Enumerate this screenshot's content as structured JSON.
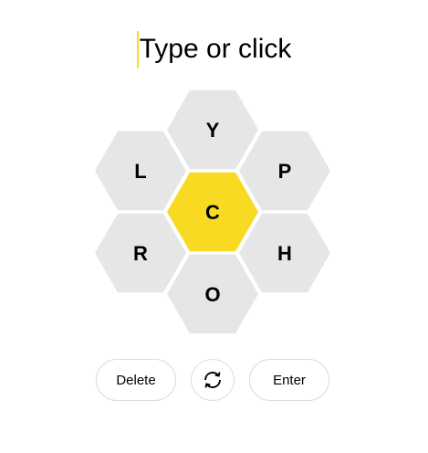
{
  "input": {
    "placeholder": "Type or click"
  },
  "hive": {
    "center_letter": "C",
    "outer_letters": [
      "Y",
      "P",
      "H",
      "O",
      "R",
      "L"
    ],
    "center_color": "#f7da21",
    "outer_color": "#e6e6e6"
  },
  "controls": {
    "delete_label": "Delete",
    "shuffle_icon": "shuffle-icon",
    "enter_label": "Enter"
  },
  "colors": {
    "accent": "#f7da21",
    "button_border": "#dcdcdc"
  }
}
